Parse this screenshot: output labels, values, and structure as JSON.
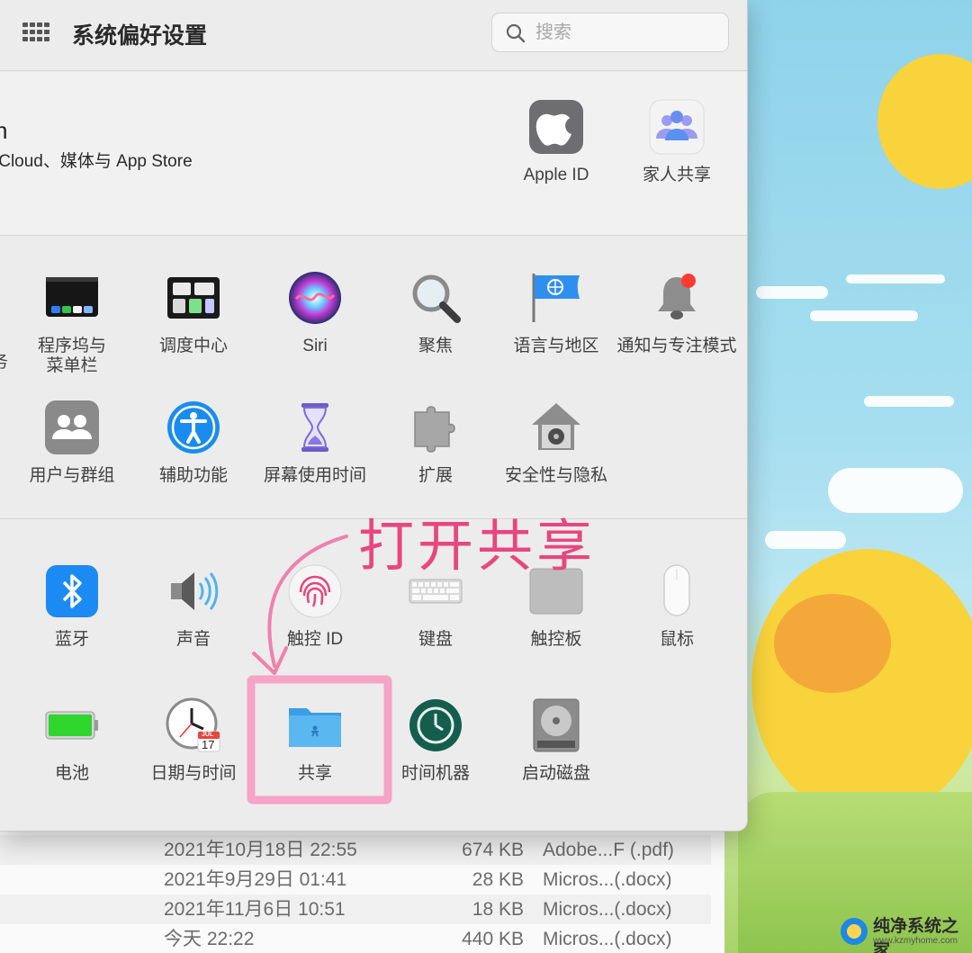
{
  "window": {
    "title": "系统偏好设置"
  },
  "search": {
    "placeholder": "搜索"
  },
  "account": {
    "name_fragment": "n",
    "subtitle": "iCloud、媒体与 App Store",
    "panes": [
      {
        "label": "Apple ID",
        "icon": "apple-logo-icon"
      },
      {
        "label": "家人共享",
        "icon": "family-sharing-icon"
      }
    ]
  },
  "main_panes": {
    "row1": [
      {
        "label": "程序坞与\n菜单栏",
        "label_line1": "程序坞与",
        "label_line2": "菜单栏",
        "icon": "dock-menubar-icon"
      },
      {
        "label": "调度中心",
        "icon": "mission-control-icon"
      },
      {
        "label": "Siri",
        "icon": "siri-icon"
      },
      {
        "label": "聚焦",
        "icon": "spotlight-magnifier-icon"
      },
      {
        "label": "语言与地区",
        "icon": "language-region-flag-icon"
      },
      {
        "label": "通知与专注模式",
        "icon": "notifications-bell-icon"
      }
    ],
    "row1_cut_label": "务",
    "row2": [
      {
        "label": "用户与群组",
        "icon": "users-groups-icon"
      },
      {
        "label": "辅助功能",
        "icon": "accessibility-icon"
      },
      {
        "label": "屏幕使用时间",
        "icon": "hourglass-icon"
      },
      {
        "label": "扩展",
        "icon": "puzzle-extension-icon"
      },
      {
        "label": "安全性与隐私",
        "icon": "security-house-icon"
      }
    ]
  },
  "hardware_panes": {
    "row1": [
      {
        "label": "蓝牙",
        "icon": "bluetooth-icon"
      },
      {
        "label": "声音",
        "icon": "speaker-icon"
      },
      {
        "label": "触控 ID",
        "icon": "fingerprint-icon"
      },
      {
        "label": "键盘",
        "icon": "keyboard-icon"
      },
      {
        "label": "触控板",
        "icon": "trackpad-icon"
      },
      {
        "label": "鼠标",
        "icon": "mouse-icon"
      }
    ],
    "row2": [
      {
        "label": "电池",
        "icon": "battery-icon"
      },
      {
        "label": "日期与时间",
        "icon": "clock-calendar-icon",
        "calendar_month": "JUL",
        "calendar_day": "17"
      },
      {
        "label": "共享",
        "icon": "sharing-folder-icon"
      },
      {
        "label": "时间机器",
        "icon": "time-machine-icon"
      },
      {
        "label": "启动磁盘",
        "icon": "startup-disk-icon"
      }
    ]
  },
  "annotation": {
    "text": "打开共享",
    "color": "#e8467e",
    "highlight_color": "#f5a3c7"
  },
  "finder_rows": [
    {
      "date": "2021年10月18日 22:55",
      "size": "674 KB",
      "kind": "Adobe...F (.pdf)"
    },
    {
      "date": "2021年9月29日 01:41",
      "size": "28 KB",
      "kind": "Micros...(.docx)"
    },
    {
      "date": "2021年11月6日 10:51",
      "size": "18 KB",
      "kind": "Micros...(.docx)"
    },
    {
      "date": "今天 22:22",
      "size": "440 KB",
      "kind": "Micros...(.docx)"
    }
  ],
  "watermark": {
    "name": "纯净系统之家",
    "url": "www.kzmyhome.com"
  }
}
